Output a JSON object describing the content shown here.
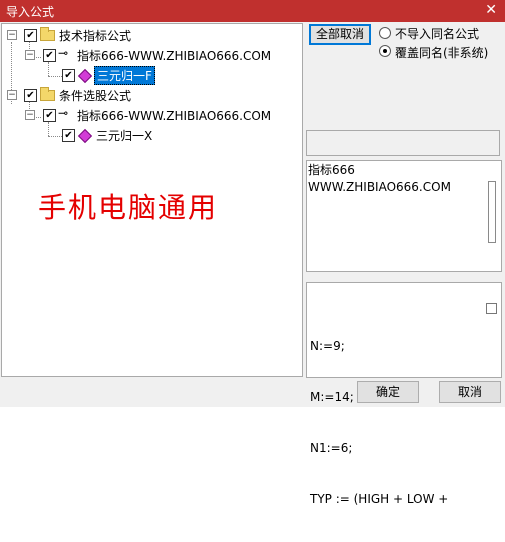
{
  "window": {
    "title": "导入公式",
    "close_glyph": "✕"
  },
  "tree": [
    {
      "label": "技术指标公式",
      "type": "folder",
      "checked": true,
      "expanded": true,
      "children": [
        {
          "label": "指标666-WWW.ZHIBIAO666.COM",
          "type": "key",
          "checked": true,
          "expanded": true,
          "children": [
            {
              "label": "三元归一F",
              "type": "formula",
              "checked": true,
              "selected": true
            }
          ]
        }
      ]
    },
    {
      "label": "条件选股公式",
      "type": "folder",
      "checked": true,
      "expanded": true,
      "children": [
        {
          "label": "指标666-WWW.ZHIBIAO666.COM",
          "type": "key",
          "checked": true,
          "expanded": true,
          "children": [
            {
              "label": "三元归一X",
              "type": "formula",
              "checked": true,
              "selected": false
            }
          ]
        }
      ]
    }
  ],
  "watermark": "手机电脑通用",
  "controls": {
    "deselect_all": "全部取消",
    "radio_skip": "不导入同名公式",
    "radio_overwrite": "覆盖同名(非系统)",
    "radio_selected": "overwrite"
  },
  "description": {
    "line1": "指标666",
    "line2": "WWW.ZHIBIAO666.COM"
  },
  "code": {
    "line1": "N:=9;",
    "line2": "M:=14;",
    "line3": "N1:=6;",
    "line4": "TYP := (HIGH + LOW +"
  },
  "buttons": {
    "ok": "确定",
    "cancel": "取消"
  },
  "colors": {
    "titlebar": "#c0302e",
    "selection": "#0078d7",
    "watermark": "#e40000"
  }
}
